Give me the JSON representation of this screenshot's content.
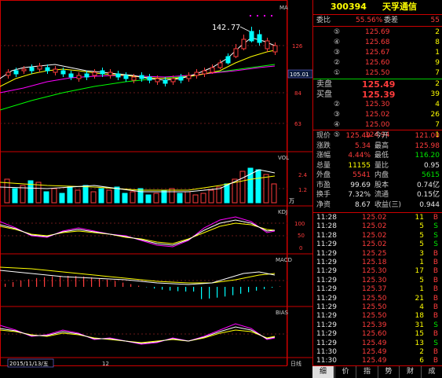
{
  "stock": {
    "code": "300394",
    "name": "天孚通信"
  },
  "chart": {
    "ma_label": "MA",
    "price_high_annot": "142.77",
    "price_axis": [
      "126",
      "105",
      "84",
      "63"
    ],
    "current_price_tag": "105.01",
    "vol_label": "VOL",
    "vol_axis": [
      "2.4",
      "1.2"
    ],
    "vol_unit": "万",
    "kdj_label": "KDJ",
    "kdj_axis": [
      "100",
      "50",
      "0"
    ],
    "macd_label": "MACD",
    "bias_label": "BIAS",
    "date_label": "2015/11/13/五",
    "month_label": "12",
    "corner_label": "日线"
  },
  "orderbook": {
    "weibi_label": "委比",
    "weibi_value": "55.56%",
    "weicha_label": "委差",
    "weicha_value": "55",
    "asks": [
      {
        "level": "⑤",
        "price": "125.69",
        "qty": "2"
      },
      {
        "level": "④",
        "price": "125.68",
        "qty": "8"
      },
      {
        "level": "③",
        "price": "125.67",
        "qty": "1"
      },
      {
        "level": "②",
        "price": "125.60",
        "qty": "9"
      },
      {
        "level": "①",
        "price": "125.50",
        "qty": "7"
      }
    ],
    "sell_label": "卖盘",
    "sell_price": "125.49",
    "sell_qty": "2",
    "buy_label": "买盘",
    "buy_price": "125.39",
    "buy_qty": "39",
    "bids": [
      {
        "level": "②",
        "price": "125.30",
        "qty": "4"
      },
      {
        "level": "③",
        "price": "125.02",
        "qty": "26"
      },
      {
        "level": "④",
        "price": "125.00",
        "qty": "7"
      },
      {
        "level": "⑤",
        "price": "124.94",
        "qty": "1"
      }
    ]
  },
  "quote": [
    {
      "l1": "现价",
      "v1": "125.49",
      "c1": "red",
      "l2": "今开",
      "v2": "121.00",
      "c2": "red"
    },
    {
      "l1": "涨跌",
      "v1": "5.34",
      "c1": "red",
      "l2": "最高",
      "v2": "125.98",
      "c2": "red"
    },
    {
      "l1": "涨幅",
      "v1": "4.44%",
      "c1": "red",
      "l2": "最低",
      "v2": "116.20",
      "c2": "green"
    },
    {
      "l1": "总量",
      "v1": "11155",
      "c1": "yellow",
      "l2": "量比",
      "v2": "0.95",
      "c2": "white"
    },
    {
      "l1": "外盘",
      "v1": "5541",
      "c1": "red",
      "l2": "内盘",
      "v2": "5615",
      "c2": "green"
    },
    {
      "l1": "市盈",
      "v1": "99.69",
      "c1": "white",
      "l2": "股本",
      "v2": "0.74亿",
      "c2": "white"
    },
    {
      "l1": "换手",
      "v1": "7.32%",
      "c1": "white",
      "l2": "流通",
      "v2": "0.15亿",
      "c2": "white"
    },
    {
      "l1": "净资",
      "v1": "8.67",
      "c1": "white",
      "l2": "收益(三)",
      "v2": "0.944",
      "c2": "white"
    }
  ],
  "ticks": [
    {
      "t": "11:28",
      "p": "125.02",
      "v": "11",
      "d": "B"
    },
    {
      "t": "11:28",
      "p": "125.02",
      "v": "5",
      "d": "S"
    },
    {
      "t": "11:28",
      "p": "125.02",
      "v": "5",
      "d": "S"
    },
    {
      "t": "11:29",
      "p": "125.02",
      "v": "5",
      "d": "S"
    },
    {
      "t": "11:29",
      "p": "125.25",
      "v": "3",
      "d": "B"
    },
    {
      "t": "11:29",
      "p": "125.18",
      "v": "1",
      "d": "B"
    },
    {
      "t": "11:29",
      "p": "125.30",
      "v": "17",
      "d": "B"
    },
    {
      "t": "11:29",
      "p": "125.30",
      "v": "5",
      "d": "B"
    },
    {
      "t": "11:29",
      "p": "125.37",
      "v": "1",
      "d": "B"
    },
    {
      "t": "11:29",
      "p": "125.50",
      "v": "21",
      "d": "B"
    },
    {
      "t": "11:29",
      "p": "125.50",
      "v": "4",
      "d": "B"
    },
    {
      "t": "11:29",
      "p": "125.50",
      "v": "18",
      "d": "B"
    },
    {
      "t": "11:29",
      "p": "125.39",
      "v": "31",
      "d": "S"
    },
    {
      "t": "11:29",
      "p": "125.60",
      "v": "15",
      "d": "B"
    },
    {
      "t": "11:29",
      "p": "125.49",
      "v": "13",
      "d": "S"
    },
    {
      "t": "11:30",
      "p": "125.49",
      "v": "2",
      "d": "B"
    },
    {
      "t": "11:30",
      "p": "125.49",
      "v": "6",
      "d": "B"
    }
  ],
  "tabs": [
    "细",
    "价",
    "指",
    "势",
    "财",
    "成"
  ],
  "colors": {
    "up": "#ff3c3c",
    "down": "#00ffff",
    "ma1": "#ffffff",
    "ma2": "#ffff00",
    "ma3": "#ff00ff",
    "ma4": "#00ff00",
    "border": "#cc0000"
  }
}
